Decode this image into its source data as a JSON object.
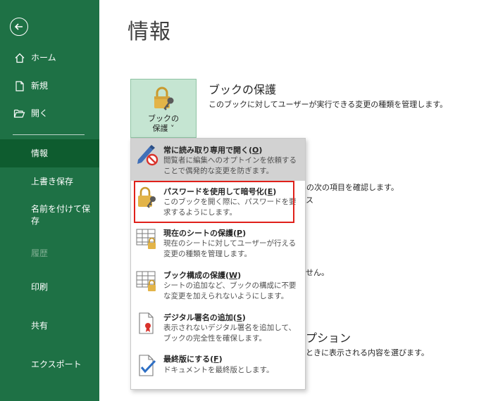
{
  "sidebar": {
    "items": [
      {
        "label": "ホーム",
        "icon": "home-icon"
      },
      {
        "label": "新規",
        "icon": "new-document-icon"
      },
      {
        "label": "開く",
        "icon": "open-folder-icon"
      },
      {
        "label": "情報"
      },
      {
        "label": "上書き保存"
      },
      {
        "label": "名前を付けて保\n存"
      },
      {
        "label": "履歴"
      },
      {
        "label": "印刷"
      },
      {
        "label": "共有"
      },
      {
        "label": "エクスポート"
      }
    ]
  },
  "main": {
    "title": "情報",
    "protect_button_label": "ブックの\n保護 ˅",
    "protect_title": "ブックの保護",
    "protect_desc": "このブックに対してユーザーが実行できる変更の種類を管理します。",
    "bg_fragments": {
      "a": "ルの次の項目を確認します。",
      "b": "ス",
      "c": "せん。",
      "d": "プション",
      "e": "ときに表示される内容を選びます。"
    }
  },
  "menu": {
    "items": [
      {
        "title": "常に読み取り専用で開く(",
        "key": "O",
        "desc": "閲覧者に編集へのオプトインを依頼することで偶発的な変更を防ぎます。"
      },
      {
        "title": "パスワードを使用して暗号化(",
        "key": "E",
        "desc": "このブックを開く際に、パスワードを要求するようにします。"
      },
      {
        "title": "現在のシートの保護(",
        "key": "P",
        "desc": "現在のシートに対してユーザーが行える変更の種類を管理します。"
      },
      {
        "title": "ブック構成の保護(",
        "key": "W",
        "desc": "シートの追加など、ブックの構成に不要な変更を加えられないようにします。"
      },
      {
        "title": "デジタル署名の追加(",
        "key": "S",
        "desc": "表示されないデジタル署名を追加して、ブックの完全性を確保します。"
      },
      {
        "title": "最終版にする(",
        "key": "F",
        "desc": "ドキュメントを最終版とします。"
      }
    ],
    "closing": ")"
  },
  "colors": {
    "sidebar_bg": "#1e7145",
    "sidebar_selected": "#0e5c2f",
    "highlight": "#e0201a",
    "lock_gold": "#e3b448"
  }
}
